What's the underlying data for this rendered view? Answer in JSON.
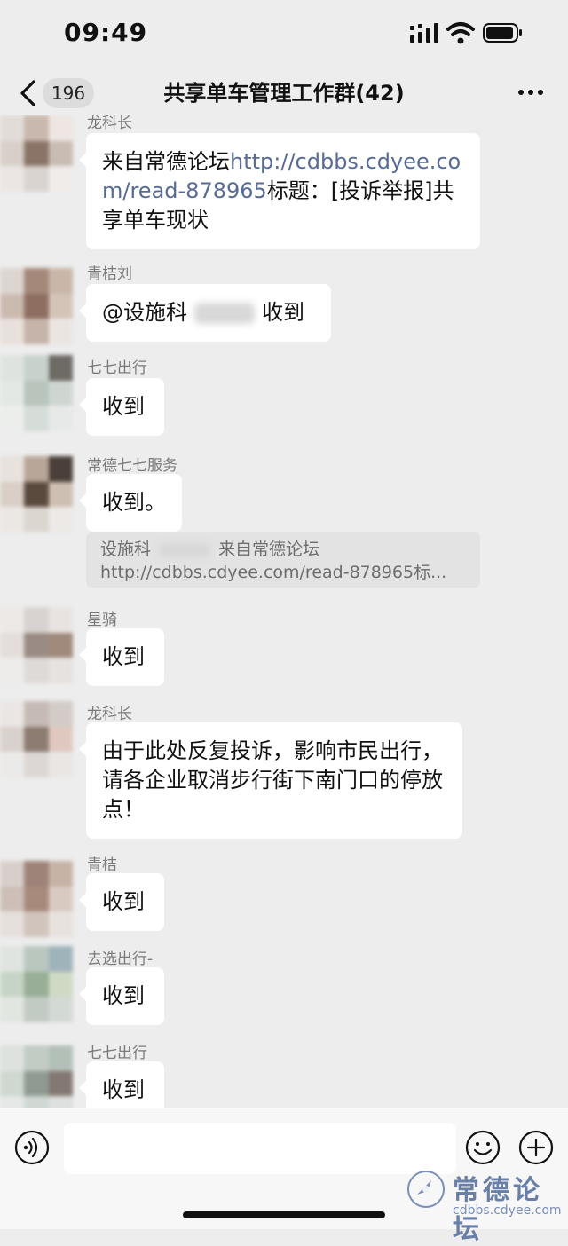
{
  "status": {
    "time": "09:49"
  },
  "header": {
    "badge": "196",
    "title": "共享单车管理工作群(42)"
  },
  "messages": [
    {
      "sender": "龙科长",
      "text_plain": "来自常德论坛",
      "link": "http://cdbbs.cdyee.co\nm/read-878965",
      "text_after": "标题：[投诉举报]共享单车现状"
    },
    {
      "sender": "青桔刘",
      "text": "@设施科",
      "text_after": "收到"
    },
    {
      "sender": "七七出行",
      "text": "收到"
    },
    {
      "sender": "常德七七服务",
      "text": "收到。",
      "quote_line1": "设施科",
      "quote_line1_after": "来自常德论坛",
      "quote_line2": "http://cdbbs.cdyee.com/read-878965标..."
    },
    {
      "sender": "星骑",
      "text": "收到"
    },
    {
      "sender": "龙科长",
      "text": "由于此处反复投诉，影响市民出行，请各企业取消步行街下南门口的停放点！"
    },
    {
      "sender": "青桔",
      "text": "收到"
    },
    {
      "sender": "去选出行-",
      "text": "收到"
    },
    {
      "sender": "七七出行",
      "text": "收到"
    }
  ],
  "input": {
    "placeholder": ""
  },
  "watermark": {
    "title": "常德论坛",
    "url": "cdbbs.cdyee.com"
  },
  "colors": {
    "background": "#ededed",
    "link": "#576b95",
    "bubble": "#ffffff"
  }
}
